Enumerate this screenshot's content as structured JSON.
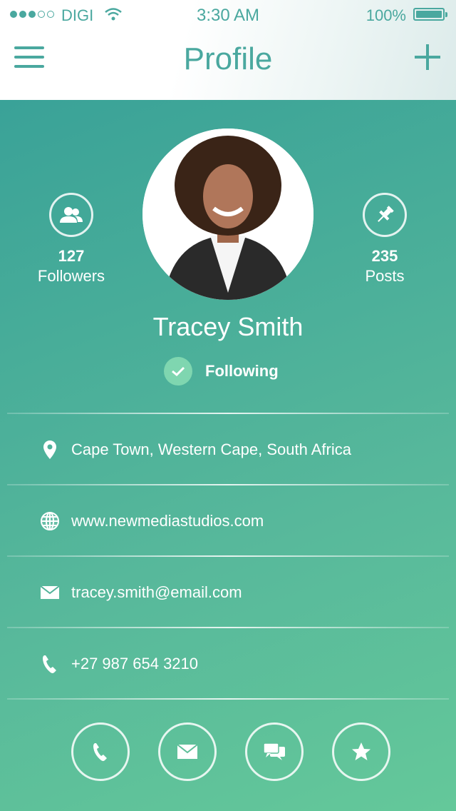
{
  "status_bar": {
    "carrier": "DIGI",
    "time": "3:30 AM",
    "battery": "100%"
  },
  "header": {
    "title": "Profile"
  },
  "profile": {
    "followers_count": "127",
    "followers_label": "Followers",
    "posts_count": "235",
    "posts_label": "Posts",
    "name": "Tracey Smith",
    "follow_status": "Following"
  },
  "info": {
    "location": "Cape Town, Western Cape, South Africa",
    "website": "www.newmediastudios.com",
    "email": "tracey.smith@email.com",
    "phone": "+27 987 654 3210"
  },
  "colors": {
    "accent": "#4aa89f",
    "gradient_start": "#3aa298",
    "gradient_end": "#64c89a"
  }
}
